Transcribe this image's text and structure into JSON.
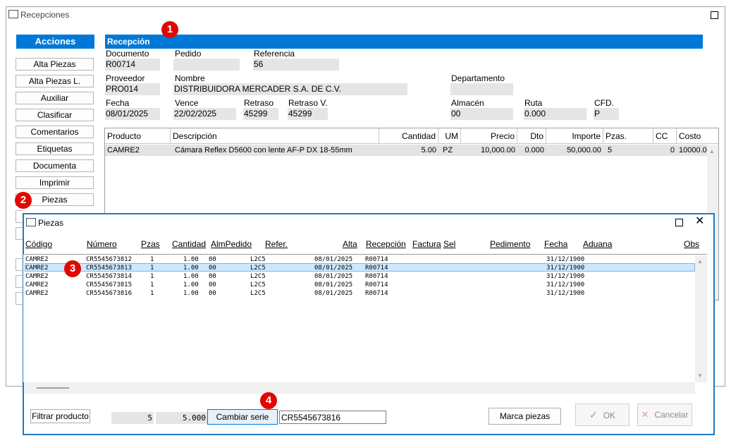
{
  "window": {
    "title": "Recepciones"
  },
  "sidebar": {
    "header": "Acciones",
    "items": [
      "Alta Piezas",
      "Alta Piezas L.",
      "Auxiliar",
      "Clasificar",
      "Comentarios",
      "Etiquetas",
      "Documenta",
      "Imprimir",
      "Piezas"
    ]
  },
  "reception": {
    "section_title": "Recepción",
    "documento": {
      "label": "Documento",
      "value": "R00714"
    },
    "pedido": {
      "label": "Pedido",
      "value": ""
    },
    "referencia": {
      "label": "Referencia",
      "value": "56"
    },
    "proveedor": {
      "label": "Proveedor",
      "value": "PRO014"
    },
    "nombre": {
      "label": "Nombre",
      "value": "DISTRIBUIDORA MERCADER S.A. DE C.V."
    },
    "departamento": {
      "label": "Departamento",
      "value": ""
    },
    "fecha": {
      "label": "Fecha",
      "value": "08/01/2025"
    },
    "vence": {
      "label": "Vence",
      "value": "22/02/2025"
    },
    "retraso": {
      "label": "Retraso",
      "value": "45299"
    },
    "retraso_v": {
      "label": "Retraso V.",
      "value": "45299"
    },
    "almacen": {
      "label": "Almacén",
      "value": "00"
    },
    "ruta": {
      "label": "Ruta",
      "value": "0.000"
    },
    "cfd": {
      "label": "CFD.",
      "value": "P"
    }
  },
  "grid": {
    "headers": [
      "Producto",
      "Descripción",
      "Cantidad",
      "UM",
      "Precio",
      "Dto",
      "Importe",
      "Pzas.",
      "CC",
      "Costo"
    ],
    "rows": [
      {
        "producto": "CAMRE2",
        "descripcion": "Cámara Reflex D5600 con lente AF-P DX 18-55mm",
        "cantidad": "5.00",
        "um": "PZ",
        "precio": "10,000.00",
        "dto": "0.000",
        "importe": "50,000.00",
        "pzas": "5",
        "cc": "0",
        "costo": "10000.0"
      }
    ]
  },
  "piezas": {
    "title": "Piezas",
    "headers": [
      "Código",
      "Número",
      "Pzas",
      "Cantidad",
      "AlmPedido",
      "Refer.",
      "Alta",
      "Recepción",
      "Factura",
      "Sel",
      "Pedimento",
      "Fecha",
      "Aduana",
      "Obs"
    ],
    "rows": [
      {
        "codigo": "CAMRE2",
        "numero": "CR5545673812",
        "pzas": "1",
        "cantidad": "1.00",
        "alm": "00",
        "refer": "L2C5",
        "alta": "08/01/2025",
        "recepcion": "R00714",
        "fecha": "31/12/1900"
      },
      {
        "codigo": "CAMRE2",
        "numero": "CR5545673813",
        "pzas": "1",
        "cantidad": "1.00",
        "alm": "00",
        "refer": "L2C5",
        "alta": "08/01/2025",
        "recepcion": "R00714",
        "fecha": "31/12/1900"
      },
      {
        "codigo": "CAMRE2",
        "numero": "CR5545673814",
        "pzas": "1",
        "cantidad": "1.00",
        "alm": "00",
        "refer": "L2C5",
        "alta": "08/01/2025",
        "recepcion": "R00714",
        "fecha": "31/12/1900"
      },
      {
        "codigo": "CAMRE2",
        "numero": "CR5545673815",
        "pzas": "1",
        "cantidad": "1.00",
        "alm": "00",
        "refer": "L2C5",
        "alta": "08/01/2025",
        "recepcion": "R00714",
        "fecha": "31/12/1900"
      },
      {
        "codigo": "CAMRE2",
        "numero": "CR5545673816",
        "pzas": "1",
        "cantidad": "1.00",
        "alm": "00",
        "refer": "L2C5",
        "alta": "08/01/2025",
        "recepcion": "R00714",
        "fecha": "31/12/1900"
      }
    ],
    "selected_row": 1,
    "footer": {
      "filtrar_label": "Filtrar producto",
      "count": "5",
      "total": "5.000",
      "cambiar_label": "Cambiar serie",
      "serie_value": "CR5545673816",
      "marca_label": "Marca piezas",
      "ok_label": "OK",
      "cancel_label": "Cancelar"
    }
  },
  "badges": [
    "1",
    "2",
    "3",
    "4"
  ],
  "icons": {
    "maximize": "maximize-icon",
    "close": "close-icon",
    "check": "check-icon",
    "x": "x-icon"
  },
  "colors": {
    "accent": "#0078d7",
    "badge": "#e10600",
    "selection": "#cce8ff"
  }
}
